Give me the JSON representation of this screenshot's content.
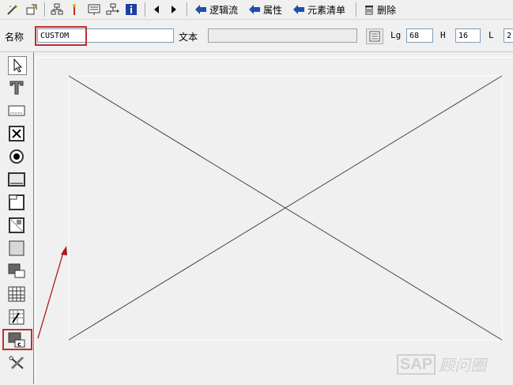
{
  "toolbar": {
    "logic_flow": "逻辑流",
    "attributes": "属性",
    "element_list": "元素清单",
    "delete": "删除"
  },
  "properties": {
    "name_label": "名称",
    "name_value": "CUSTOM",
    "text_label": "文本",
    "text_value": "",
    "lg_label": "Lg",
    "lg_value": "68",
    "h_label": "H",
    "h_value": "16",
    "l_label": "L",
    "l_value": "2"
  },
  "palette": {
    "items": [
      "pointer",
      "text",
      "input-field",
      "checkbox",
      "radio-button",
      "pushbutton",
      "frame",
      "subscreen",
      "table-control",
      "tabstrip",
      "table-wizard",
      "status-icon",
      "custom-control",
      "tools"
    ],
    "selected": "custom-control"
  },
  "watermark": {
    "sap": "SAP",
    "cn": "顾问圈"
  },
  "colors": {
    "highlight": "#c0302b",
    "arrow": "#b01818"
  }
}
